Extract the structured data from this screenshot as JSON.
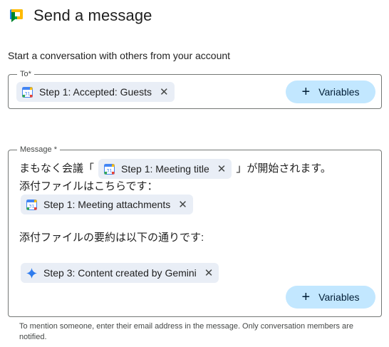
{
  "header": {
    "title": "Send a message",
    "icon": "google-chat-icon"
  },
  "subtitle": "Start a conversation with others from your account",
  "to_field": {
    "label": "To*",
    "chip": {
      "icon": "google-calendar-icon",
      "label": "Step 1: Accepted: Guests"
    },
    "variables_label": "Variables"
  },
  "message_field": {
    "label": "Message *",
    "line1_prefix": "まもなく会議「",
    "line1_chip": {
      "icon": "google-calendar-icon",
      "label": "Step 1: Meeting title"
    },
    "line1_suffix": "」が開始されます。",
    "line2": "添付ファイルはこちらです：",
    "line3_chip": {
      "icon": "google-calendar-icon",
      "label": "Step 1: Meeting attachments"
    },
    "line4": "添付ファイルの要約は以下の通りです:",
    "line5_chip": {
      "icon": "gemini-sparkle-icon",
      "label": "Step 3: Content created by Gemini"
    },
    "variables_label": "Variables"
  },
  "footnote": "To mention someone, enter their email address in the message. Only conversation members are notified.",
  "colors": {
    "chip_bg": "#e9eef6",
    "button_bg": "#c2e7ff",
    "border": "#747775"
  }
}
